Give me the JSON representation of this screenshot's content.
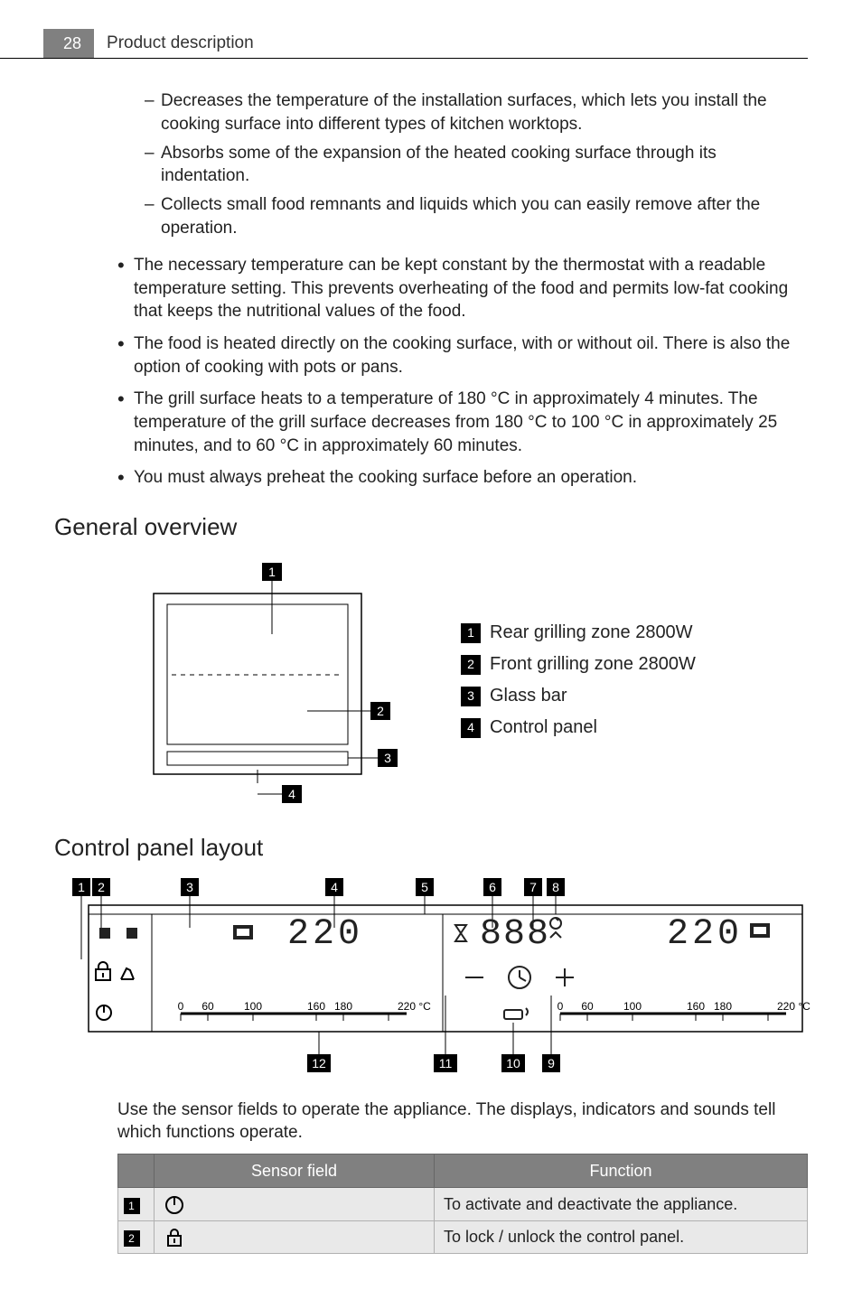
{
  "header": {
    "page_number": "28",
    "title": "Product description"
  },
  "sublist": [
    "Decreases the temperature of the installation surfaces, which lets you install the cooking surface into different types of kitchen worktops.",
    "Absorbs some of the expansion of the heated cooking surface through its indentation.",
    "Collects small food remnants and liquids which you can easily remove after the operation."
  ],
  "mainlist": [
    "The necessary temperature can be kept constant by the thermostat with a readable temperature setting. This prevents overheating of the food and permits low-fat cooking that keeps the nutritional values of the food.",
    "The food is heated directly on the cooking surface, with or without oil. There is also the option of cooking with pots or pans.",
    "The grill surface heats to a temperature of 180 °C in approximately 4 minutes. The temperature of the grill surface decreases from 180 °C to 100 °C in approximately 25 minutes, and to 60 °C in approximately 60 minutes.",
    "You must always preheat the cooking surface before an operation."
  ],
  "sections": {
    "overview": "General overview",
    "panel": "Control panel layout"
  },
  "overview_legend": [
    {
      "num": "1",
      "label": "Rear grilling zone 2800W"
    },
    {
      "num": "2",
      "label": "Front grilling zone 2800W"
    },
    {
      "num": "3",
      "label": "Glass bar"
    },
    {
      "num": "4",
      "label": "Control panel"
    }
  ],
  "panel_callouts_top": [
    "1",
    "2",
    "3",
    "4",
    "5",
    "6",
    "7",
    "8"
  ],
  "panel_callouts_bottom": [
    "12",
    "11",
    "10",
    "9"
  ],
  "panel_display": {
    "left_temp": "220",
    "mid_digits": "888",
    "right_temp": "220",
    "scale_left": [
      "0",
      "60",
      "100",
      "160",
      "180",
      "220 °C"
    ],
    "scale_right": [
      "0",
      "60",
      "100",
      "160",
      "180",
      "220 °C"
    ]
  },
  "table_intro": "Use the sensor fields to operate the appliance. The displays, indicators and sounds tell which functions operate.",
  "table": {
    "headers": {
      "sensor": "Sensor field",
      "function": "Function"
    },
    "rows": [
      {
        "num": "1",
        "icon": "power-icon",
        "function": "To activate and deactivate the appliance."
      },
      {
        "num": "2",
        "icon": "lock-icon",
        "function": "To lock / unlock the control panel."
      }
    ]
  }
}
